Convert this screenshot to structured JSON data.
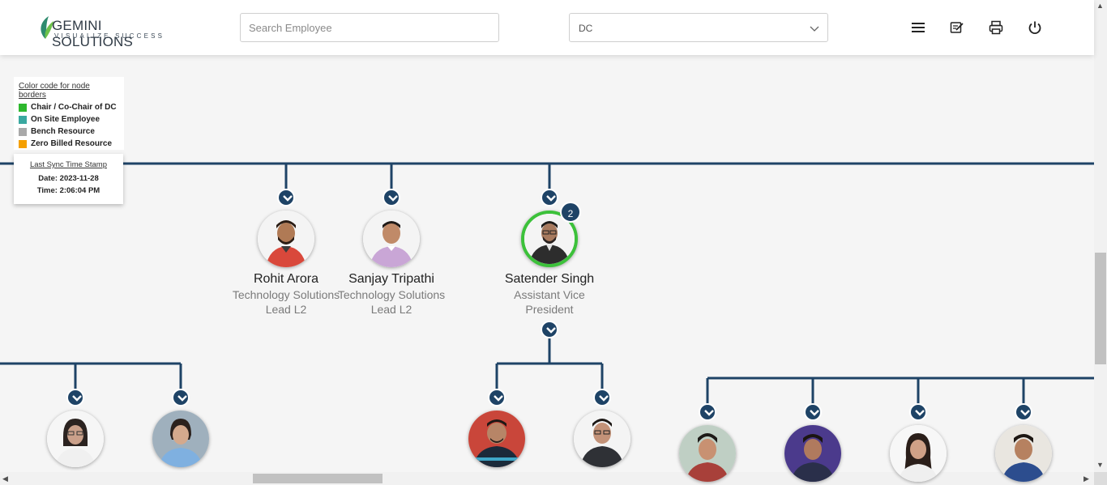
{
  "header": {
    "logo_text": "GEMINI SOLUTIONS",
    "logo_tagline": "VISUALIZE SUCCESS",
    "search_placeholder": "Search Employee",
    "dc_select_value": "DC",
    "icons": [
      "menu-icon",
      "edit-note-icon",
      "print-icon",
      "power-icon"
    ]
  },
  "legend": {
    "title": "Color code for node borders",
    "items": [
      {
        "label": "Chair / Co-Chair of DC",
        "color": "#2eb82e"
      },
      {
        "label": "On Site Employee",
        "color": "#3aa8a0"
      },
      {
        "label": "Bench Resource",
        "color": "#a9a9a9"
      },
      {
        "label": "Zero Billed Resource",
        "color": "#f5a000"
      }
    ]
  },
  "sync": {
    "title": "Last Sync Time Stamp",
    "date": "Date: 2023-11-28",
    "time": "Time: 2:06:04 PM"
  },
  "nodes": [
    {
      "name": "Rohit Arora",
      "title": "Technology Solutions Lead L2"
    },
    {
      "name": "Sanjay Tripathi",
      "title": "Technology Solutions Lead L2"
    },
    {
      "name": "Satender Singh",
      "title": "Assistant Vice President",
      "badge": "2"
    }
  ],
  "colors": {
    "line": "#1e4366",
    "chair_border": "#3cc13a"
  }
}
